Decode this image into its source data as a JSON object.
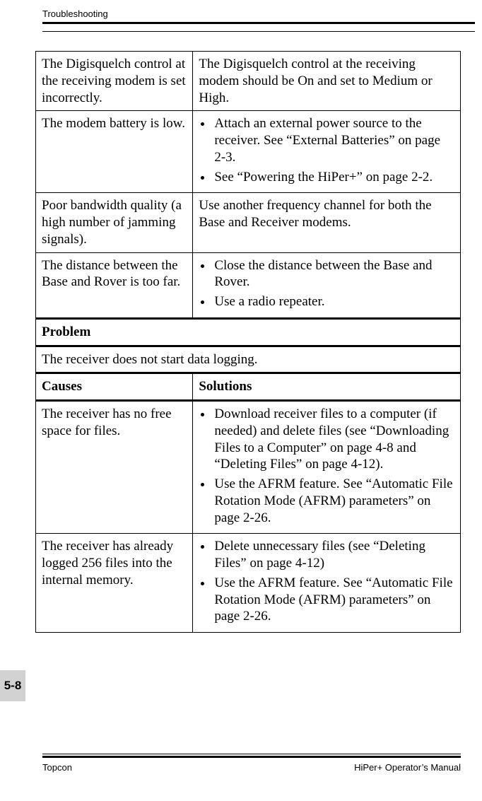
{
  "header": {
    "running_head": "Troubleshooting"
  },
  "rows": [
    {
      "cause": "The Digisquelch control at the receiving modem is set incorrectly.",
      "solution_text": "The Digisquelch control at the receiving modem should be On and set to Medium or High."
    },
    {
      "cause": "The modem battery is low.",
      "bullets": [
        "Attach an external power source to the receiver. See “External Batteries” on page 2-3.",
        "See “Powering the HiPer+” on page 2-2."
      ]
    },
    {
      "cause": "Poor bandwidth quality (a high number of jamming signals).",
      "solution_text": "Use another frequency channel for both the Base and Receiver modems."
    },
    {
      "cause": "The distance between the Base and Rover is too far.",
      "bullets": [
        "Close the distance between the Base and Rover.",
        "Use a radio repeater."
      ]
    }
  ],
  "problem_label": "Problem",
  "problem_text": "The receiver does not start data logging.",
  "cs_header": {
    "causes": "Causes",
    "solutions": "Solutions"
  },
  "rows2": [
    {
      "cause": "The receiver has no free space for files.",
      "bullets": [
        "Download receiver files to a computer (if needed) and delete files (see “Downloading Files to a Computer” on page 4-8 and “Deleting Files” on page 4-12).",
        "Use the AFRM feature. See “Automatic File Rotation Mode (AFRM) parameters” on page 2-26."
      ]
    },
    {
      "cause": "The receiver has already logged 256 files into the internal memory.",
      "bullets": [
        "Delete unnecessary files (see “Deleting Files” on page 4-12)",
        "Use the AFRM feature. See “Automatic File Rotation Mode (AFRM) parameters” on page 2-26."
      ]
    }
  ],
  "page_tab": "5-8",
  "footer": {
    "left": "Topcon",
    "right": "HiPer+ Operator’s Manual"
  }
}
